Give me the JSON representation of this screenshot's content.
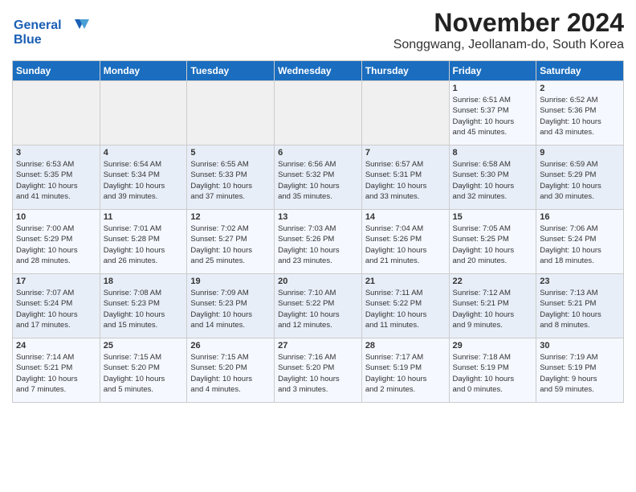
{
  "logo": {
    "line1": "General",
    "line2": "Blue"
  },
  "header": {
    "month_year": "November 2024",
    "location": "Songgwang, Jeollanam-do, South Korea"
  },
  "weekdays": [
    "Sunday",
    "Monday",
    "Tuesday",
    "Wednesday",
    "Thursday",
    "Friday",
    "Saturday"
  ],
  "weeks": [
    [
      {
        "day": "",
        "info": ""
      },
      {
        "day": "",
        "info": ""
      },
      {
        "day": "",
        "info": ""
      },
      {
        "day": "",
        "info": ""
      },
      {
        "day": "",
        "info": ""
      },
      {
        "day": "1",
        "info": "Sunrise: 6:51 AM\nSunset: 5:37 PM\nDaylight: 10 hours\nand 45 minutes."
      },
      {
        "day": "2",
        "info": "Sunrise: 6:52 AM\nSunset: 5:36 PM\nDaylight: 10 hours\nand 43 minutes."
      }
    ],
    [
      {
        "day": "3",
        "info": "Sunrise: 6:53 AM\nSunset: 5:35 PM\nDaylight: 10 hours\nand 41 minutes."
      },
      {
        "day": "4",
        "info": "Sunrise: 6:54 AM\nSunset: 5:34 PM\nDaylight: 10 hours\nand 39 minutes."
      },
      {
        "day": "5",
        "info": "Sunrise: 6:55 AM\nSunset: 5:33 PM\nDaylight: 10 hours\nand 37 minutes."
      },
      {
        "day": "6",
        "info": "Sunrise: 6:56 AM\nSunset: 5:32 PM\nDaylight: 10 hours\nand 35 minutes."
      },
      {
        "day": "7",
        "info": "Sunrise: 6:57 AM\nSunset: 5:31 PM\nDaylight: 10 hours\nand 33 minutes."
      },
      {
        "day": "8",
        "info": "Sunrise: 6:58 AM\nSunset: 5:30 PM\nDaylight: 10 hours\nand 32 minutes."
      },
      {
        "day": "9",
        "info": "Sunrise: 6:59 AM\nSunset: 5:29 PM\nDaylight: 10 hours\nand 30 minutes."
      }
    ],
    [
      {
        "day": "10",
        "info": "Sunrise: 7:00 AM\nSunset: 5:29 PM\nDaylight: 10 hours\nand 28 minutes."
      },
      {
        "day": "11",
        "info": "Sunrise: 7:01 AM\nSunset: 5:28 PM\nDaylight: 10 hours\nand 26 minutes."
      },
      {
        "day": "12",
        "info": "Sunrise: 7:02 AM\nSunset: 5:27 PM\nDaylight: 10 hours\nand 25 minutes."
      },
      {
        "day": "13",
        "info": "Sunrise: 7:03 AM\nSunset: 5:26 PM\nDaylight: 10 hours\nand 23 minutes."
      },
      {
        "day": "14",
        "info": "Sunrise: 7:04 AM\nSunset: 5:26 PM\nDaylight: 10 hours\nand 21 minutes."
      },
      {
        "day": "15",
        "info": "Sunrise: 7:05 AM\nSunset: 5:25 PM\nDaylight: 10 hours\nand 20 minutes."
      },
      {
        "day": "16",
        "info": "Sunrise: 7:06 AM\nSunset: 5:24 PM\nDaylight: 10 hours\nand 18 minutes."
      }
    ],
    [
      {
        "day": "17",
        "info": "Sunrise: 7:07 AM\nSunset: 5:24 PM\nDaylight: 10 hours\nand 17 minutes."
      },
      {
        "day": "18",
        "info": "Sunrise: 7:08 AM\nSunset: 5:23 PM\nDaylight: 10 hours\nand 15 minutes."
      },
      {
        "day": "19",
        "info": "Sunrise: 7:09 AM\nSunset: 5:23 PM\nDaylight: 10 hours\nand 14 minutes."
      },
      {
        "day": "20",
        "info": "Sunrise: 7:10 AM\nSunset: 5:22 PM\nDaylight: 10 hours\nand 12 minutes."
      },
      {
        "day": "21",
        "info": "Sunrise: 7:11 AM\nSunset: 5:22 PM\nDaylight: 10 hours\nand 11 minutes."
      },
      {
        "day": "22",
        "info": "Sunrise: 7:12 AM\nSunset: 5:21 PM\nDaylight: 10 hours\nand 9 minutes."
      },
      {
        "day": "23",
        "info": "Sunrise: 7:13 AM\nSunset: 5:21 PM\nDaylight: 10 hours\nand 8 minutes."
      }
    ],
    [
      {
        "day": "24",
        "info": "Sunrise: 7:14 AM\nSunset: 5:21 PM\nDaylight: 10 hours\nand 7 minutes."
      },
      {
        "day": "25",
        "info": "Sunrise: 7:15 AM\nSunset: 5:20 PM\nDaylight: 10 hours\nand 5 minutes."
      },
      {
        "day": "26",
        "info": "Sunrise: 7:15 AM\nSunset: 5:20 PM\nDaylight: 10 hours\nand 4 minutes."
      },
      {
        "day": "27",
        "info": "Sunrise: 7:16 AM\nSunset: 5:20 PM\nDaylight: 10 hours\nand 3 minutes."
      },
      {
        "day": "28",
        "info": "Sunrise: 7:17 AM\nSunset: 5:19 PM\nDaylight: 10 hours\nand 2 minutes."
      },
      {
        "day": "29",
        "info": "Sunrise: 7:18 AM\nSunset: 5:19 PM\nDaylight: 10 hours\nand 0 minutes."
      },
      {
        "day": "30",
        "info": "Sunrise: 7:19 AM\nSunset: 5:19 PM\nDaylight: 9 hours\nand 59 minutes."
      }
    ]
  ]
}
